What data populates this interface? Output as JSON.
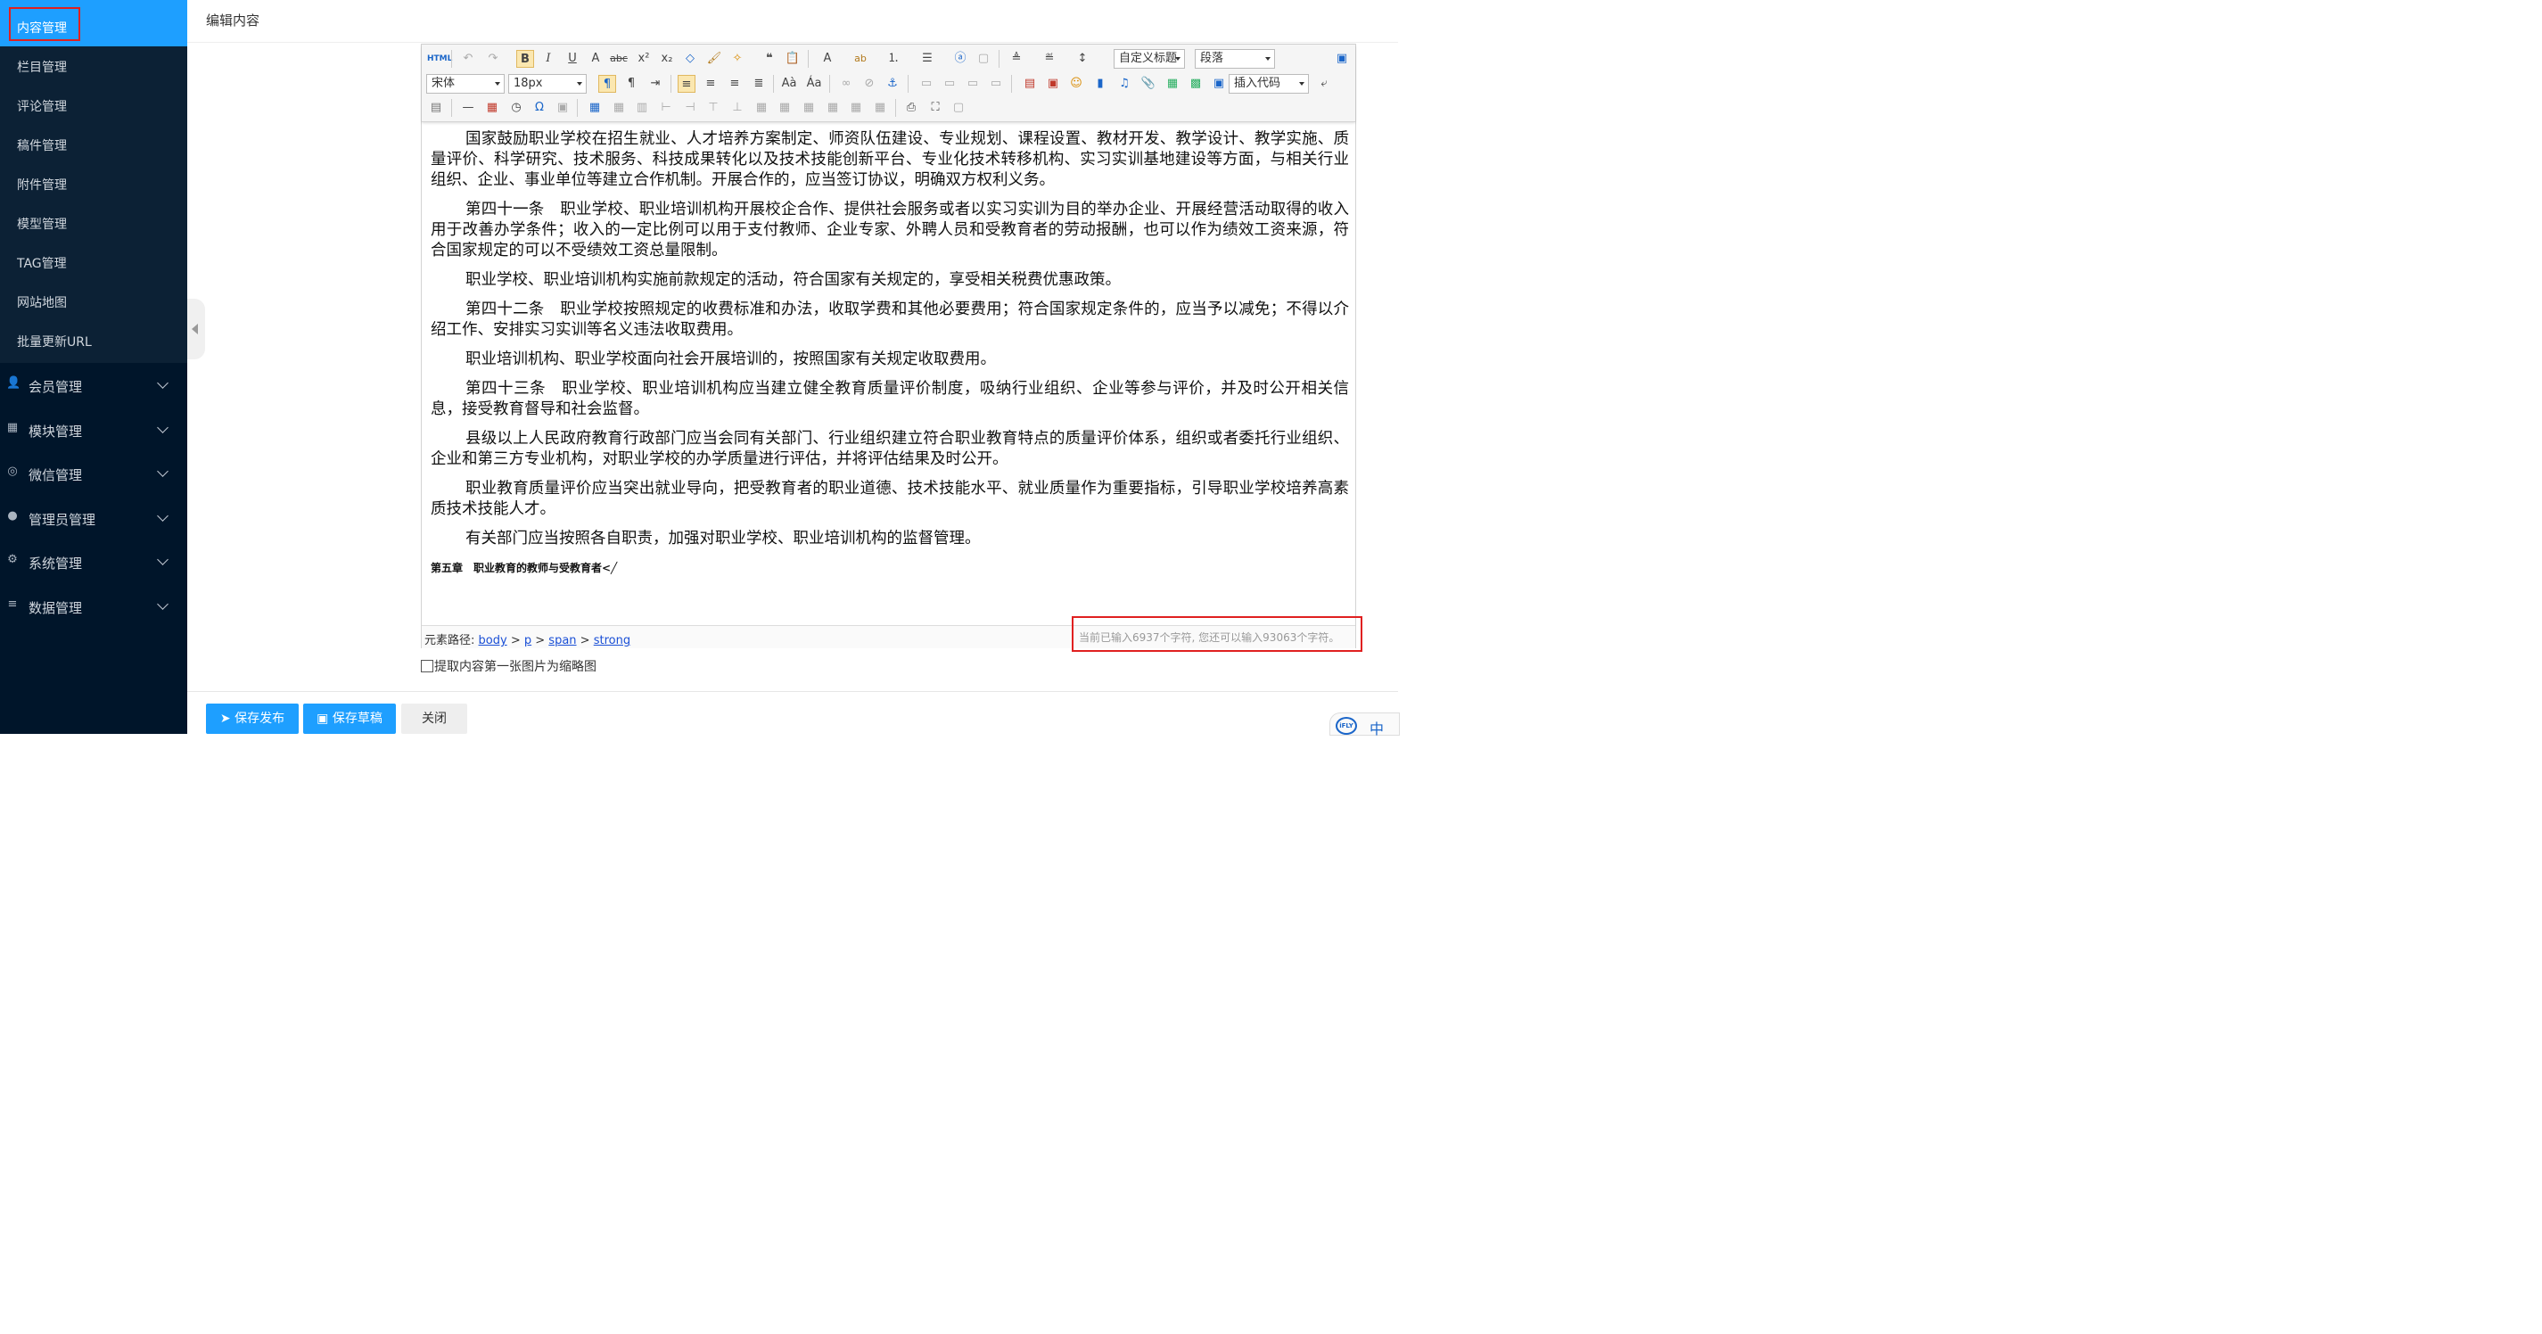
{
  "sidebar": {
    "active_item": "内容管理",
    "sub_items": [
      "栏目管理",
      "评论管理",
      "稿件管理",
      "附件管理",
      "模型管理",
      "TAG管理",
      "网站地图",
      "批量更新URL"
    ],
    "groups": [
      {
        "label": "会员管理",
        "icon": "user-icon"
      },
      {
        "label": "模块管理",
        "icon": "grid-icon"
      },
      {
        "label": "微信管理",
        "icon": "wechat-icon"
      },
      {
        "label": "管理员管理",
        "icon": "admin-icon"
      },
      {
        "label": "系统管理",
        "icon": "gear-icon"
      },
      {
        "label": "数据管理",
        "icon": "database-icon"
      }
    ]
  },
  "header": {
    "title": "编辑内容"
  },
  "editor": {
    "toolbar": {
      "html_label": "HTML",
      "heading_select": "自定义标题",
      "paragraph_select": "段落",
      "font_family": "宋体",
      "font_size": "18px",
      "insert_code": "插入代码"
    },
    "paragraphs": [
      "国家鼓励职业学校在招生就业、人才培养方案制定、师资队伍建设、专业规划、课程设置、教材开发、教学设计、教学实施、质量评价、科学研究、技术服务、科技成果转化以及技术技能创新平台、专业化技术转移机构、实习实训基地建设等方面，与相关行业组织、企业、事业单位等建立合作机制。开展合作的，应当签订协议，明确双方权利义务。",
      "第四十一条　职业学校、职业培训机构开展校企合作、提供社会服务或者以实习实训为目的举办企业、开展经营活动取得的收入用于改善办学条件；收入的一定比例可以用于支付教师、企业专家、外聘人员和受教育者的劳动报酬，也可以作为绩效工资来源，符合国家规定的可以不受绩效工资总量限制。",
      "职业学校、职业培训机构实施前款规定的活动，符合国家有关规定的，享受相关税费优惠政策。",
      "第四十二条　职业学校按照规定的收费标准和办法，收取学费和其他必要费用；符合国家规定条件的，应当予以减免；不得以介绍工作、安排实习实训等名义违法收取费用。",
      "职业培训机构、职业学校面向社会开展培训的，按照国家有关规定收取费用。",
      "第四十三条　职业学校、职业培训机构应当建立健全教育质量评价制度，吸纳行业组织、企业等参与评价，并及时公开相关信息，接受教育督导和社会监督。",
      "县级以上人民政府教育行政部门应当会同有关部门、行业组织建立符合职业教育特点的质量评价体系，组织或者委托行业组织、企业和第三方专业机构，对职业学校的办学质量进行评估，并将评估结果及时公开。",
      "职业教育质量评价应当突出就业导向，把受教育者的职业道德、技术技能水平、就业质量作为重要指标，引导职业学校培养高素质技术技能人才。",
      "有关部门应当按照各自职责，加强对职业学校、职业培训机构的监督管理。"
    ],
    "chapter_heading": "第五章　职业教育的教师与受教育者<╱",
    "path": {
      "label": "元素路径:",
      "items": [
        "body",
        "p",
        "span",
        "strong"
      ]
    },
    "char_count": "当前已输入6937个字符, 您还可以输入93063个字符。"
  },
  "thumbnail_option": "提取内容第一张图片为缩略图",
  "footer": {
    "publish": "保存发布",
    "draft": "保存草稿",
    "close": "关闭"
  },
  "ime": {
    "mode": "中",
    "logo": "iFLY"
  },
  "colors": {
    "sidebar_bg": "#00152a",
    "active": "#1e9fff",
    "highlight_border": "#e02020"
  }
}
